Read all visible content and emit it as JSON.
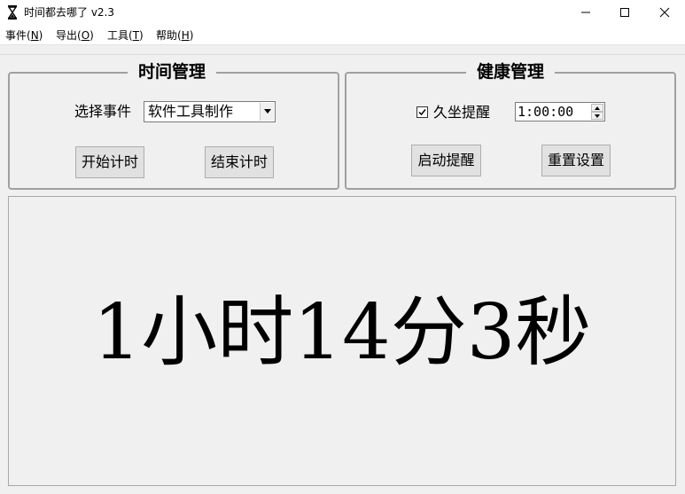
{
  "window": {
    "title": "时间都去哪了 v2.3",
    "icon": "hourglass-icon",
    "controls": [
      "minimize-icon",
      "maximize-icon",
      "close-icon"
    ]
  },
  "menu": [
    {
      "label": "事件(",
      "key": "N",
      "suffix": ")"
    },
    {
      "label": "导出(",
      "key": "O",
      "suffix": ")"
    },
    {
      "label": "工具(",
      "key": "T",
      "suffix": ")"
    },
    {
      "label": "帮助(",
      "key": "H",
      "suffix": ")"
    }
  ],
  "time_group": {
    "title": "时间管理",
    "select_label": "选择事件",
    "selected_event": "软件工具制作",
    "start_button": "开始计时",
    "end_button": "结束计时"
  },
  "health_group": {
    "title": "健康管理",
    "sedentary_label": "久坐提醒",
    "sedentary_checked": true,
    "interval": "1:00:00",
    "remind_button": "启动提醒",
    "reset_button": "重置设置"
  },
  "display": {
    "elapsed": "1小时14分3秒"
  }
}
